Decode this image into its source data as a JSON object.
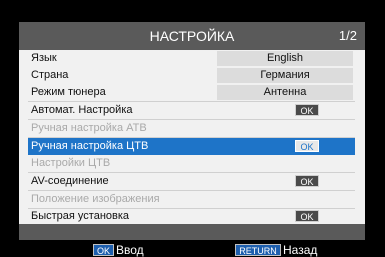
{
  "title": "НАСТРОЙКА",
  "page_indicator": "1/2",
  "menu": [
    {
      "label": "Язык",
      "value": "English"
    },
    {
      "label": "Страна",
      "value": "Германия"
    },
    {
      "label": "Режим тюнера",
      "value": "Антенна"
    },
    {
      "label": "Автомат. Настройка",
      "button": "OK"
    },
    {
      "label": "Ручная настройка ATB",
      "disabled": true
    },
    {
      "label": "Ручная настройка ЦТВ",
      "button": "OK",
      "selected": true
    },
    {
      "label": "Настройки ЦТВ",
      "disabled": true
    },
    {
      "label": "AV-соединение",
      "button": "OK"
    },
    {
      "label": "Положение изображения",
      "disabled": true
    },
    {
      "label": "Быстрая установка",
      "button": "OK"
    }
  ],
  "footer": {
    "ok_key": "OK",
    "ok_label": "Ввод",
    "return_key": "RETURN",
    "return_label": "Назад"
  },
  "colors": {
    "highlight": "#1e74c8",
    "panel": "#f1f1f1",
    "bar": "#5a5a5a"
  }
}
